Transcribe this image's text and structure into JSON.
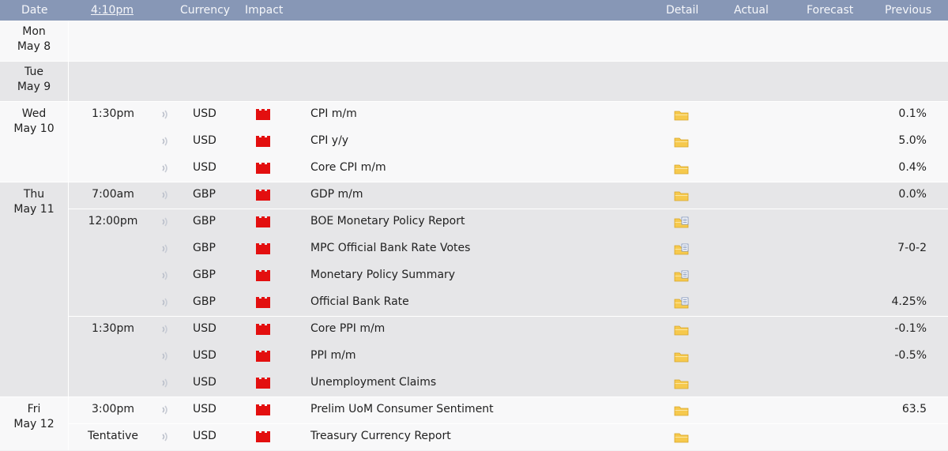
{
  "header": {
    "date": "Date",
    "time": "4:10pm",
    "currency": "Currency",
    "impact": "Impact",
    "detail": "Detail",
    "actual": "Actual",
    "forecast": "Forecast",
    "previous": "Previous"
  },
  "colors": {
    "header_bg": "#8797b6",
    "impact_high": "#e30f0f",
    "folder": "#f6c94d"
  },
  "days": [
    {
      "weekday": "Mon",
      "date": "May 8",
      "events": []
    },
    {
      "weekday": "Tue",
      "date": "May 9",
      "events": []
    },
    {
      "weekday": "Wed",
      "date": "May 10",
      "events": [
        {
          "time": "1:30pm",
          "currency": "USD",
          "impact": "high",
          "event": "CPI m/m",
          "detail_icon": "folder-icon",
          "actual": "",
          "forecast": "",
          "previous": "0.1%"
        },
        {
          "time": "",
          "currency": "USD",
          "impact": "high",
          "event": "CPI y/y",
          "detail_icon": "folder-icon",
          "actual": "",
          "forecast": "",
          "previous": "5.0%"
        },
        {
          "time": "",
          "currency": "USD",
          "impact": "high",
          "event": "Core CPI m/m",
          "detail_icon": "folder-icon",
          "actual": "",
          "forecast": "",
          "previous": "0.4%"
        }
      ]
    },
    {
      "weekday": "Thu",
      "date": "May 11",
      "events": [
        {
          "time": "7:00am",
          "currency": "GBP",
          "impact": "high",
          "event": "GDP m/m",
          "detail_icon": "folder-icon",
          "actual": "",
          "forecast": "",
          "previous": "0.0%"
        },
        {
          "time": "12:00pm",
          "currency": "GBP",
          "impact": "high",
          "event": "BOE Monetary Policy Report",
          "detail_icon": "folder-doc-icon",
          "actual": "",
          "forecast": "",
          "previous": ""
        },
        {
          "time": "",
          "currency": "GBP",
          "impact": "high",
          "event": "MPC Official Bank Rate Votes",
          "detail_icon": "folder-doc-icon",
          "actual": "",
          "forecast": "",
          "previous": "7-0-2"
        },
        {
          "time": "",
          "currency": "GBP",
          "impact": "high",
          "event": "Monetary Policy Summary",
          "detail_icon": "folder-doc-icon",
          "actual": "",
          "forecast": "",
          "previous": ""
        },
        {
          "time": "",
          "currency": "GBP",
          "impact": "high",
          "event": "Official Bank Rate",
          "detail_icon": "folder-doc-icon",
          "actual": "",
          "forecast": "",
          "previous": "4.25%"
        },
        {
          "time": "1:30pm",
          "currency": "USD",
          "impact": "high",
          "event": "Core PPI m/m",
          "detail_icon": "folder-icon",
          "actual": "",
          "forecast": "",
          "previous": "-0.1%"
        },
        {
          "time": "",
          "currency": "USD",
          "impact": "high",
          "event": "PPI m/m",
          "detail_icon": "folder-icon",
          "actual": "",
          "forecast": "",
          "previous": "-0.5%"
        },
        {
          "time": "",
          "currency": "USD",
          "impact": "high",
          "event": "Unemployment Claims",
          "detail_icon": "folder-icon",
          "actual": "",
          "forecast": "",
          "previous": ""
        }
      ]
    },
    {
      "weekday": "Fri",
      "date": "May 12",
      "events": [
        {
          "time": "3:00pm",
          "currency": "USD",
          "impact": "high",
          "event": "Prelim UoM Consumer Sentiment",
          "detail_icon": "folder-icon",
          "actual": "",
          "forecast": "",
          "previous": "63.5"
        },
        {
          "time": "Tentative",
          "currency": "USD",
          "impact": "high",
          "event": "Treasury Currency Report",
          "detail_icon": "folder-icon",
          "actual": "",
          "forecast": "",
          "previous": ""
        }
      ]
    }
  ]
}
